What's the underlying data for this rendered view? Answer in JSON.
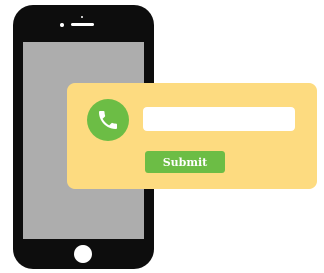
{
  "form": {
    "field_value": "",
    "field_placeholder": "",
    "submit_label": "Submit"
  },
  "icons": {
    "call": "phone-handset-icon"
  },
  "colors": {
    "phone_body": "#0d0d0d",
    "phone_screen": "#adadad",
    "card_background": "#fddb80",
    "accent_green": "#6cbd45",
    "field_background": "#ffffff"
  }
}
